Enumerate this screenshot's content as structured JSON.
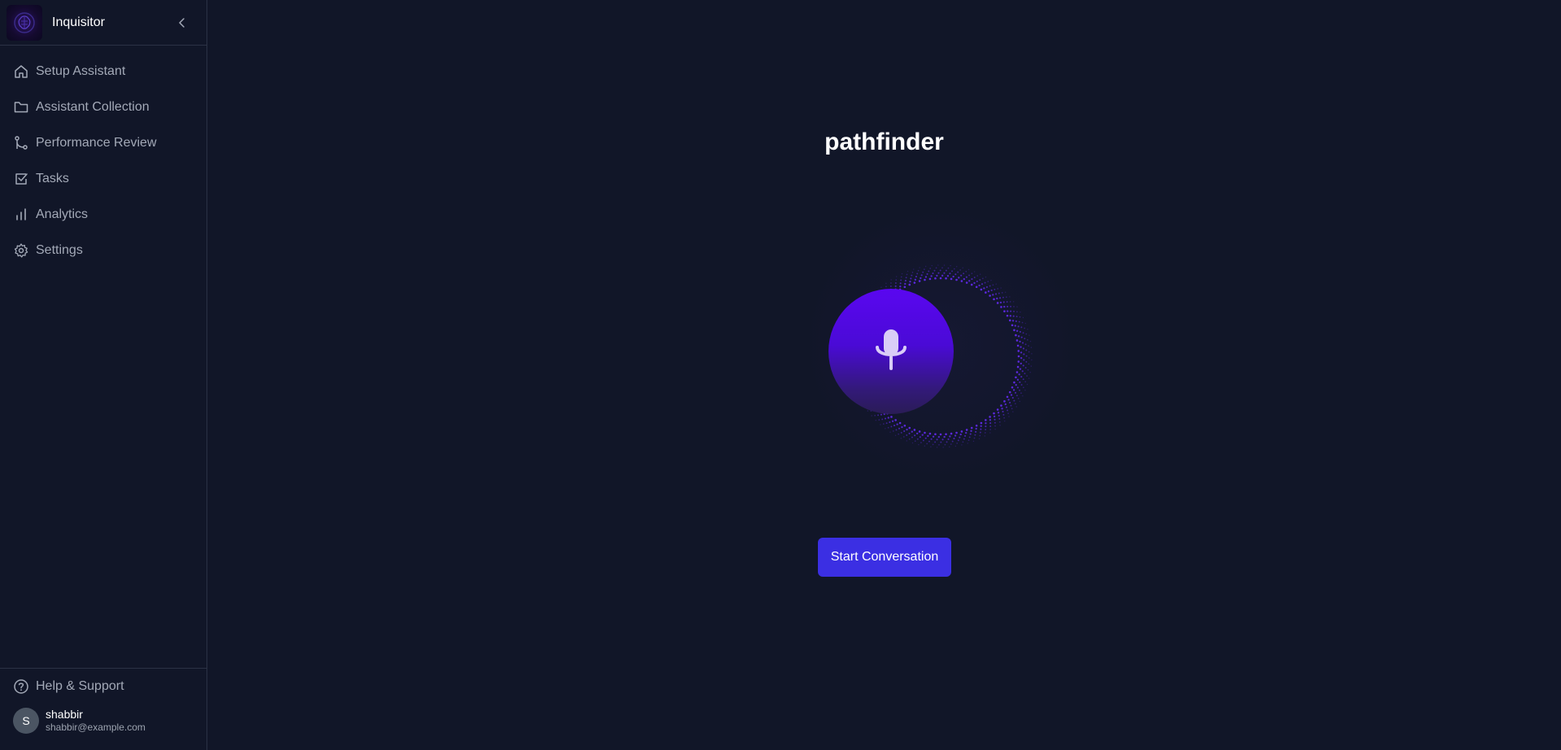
{
  "sidebar": {
    "app_name": "Inquisitor",
    "logo_icon": "brain-logo",
    "collapse_icon": "chevron-left-icon",
    "items": [
      {
        "label": "Setup Assistant",
        "icon": "home-icon"
      },
      {
        "label": "Assistant Collection",
        "icon": "folder-icon"
      },
      {
        "label": "Performance Review",
        "icon": "git-branch-icon"
      },
      {
        "label": "Tasks",
        "icon": "checkbox-icon"
      },
      {
        "label": "Analytics",
        "icon": "bar-chart-icon"
      },
      {
        "label": "Settings",
        "icon": "gear-icon"
      }
    ],
    "footer": {
      "help_label": "Help & Support",
      "help_icon": "help-circle-icon",
      "user": {
        "initial": "S",
        "name": "shabbir",
        "email": "shabbir@example.com"
      }
    }
  },
  "main": {
    "title": "pathfinder",
    "mic_icon": "microphone-icon",
    "start_button_label": "Start Conversation"
  },
  "colors": {
    "background": "#111628",
    "accent": "#3b2fe3",
    "orb": "#5a07f0",
    "dots": "#6a2cff"
  }
}
